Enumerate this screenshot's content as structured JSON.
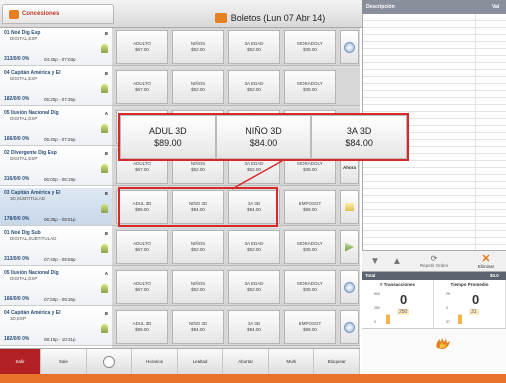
{
  "header": {
    "conc_tab": "Concesiones",
    "boletos_tab": "Boletos (Lun 07 Abr 14)"
  },
  "right_header": {
    "col1": "Descripción",
    "col2": "Val"
  },
  "movies": [
    {
      "title": "01 Noé Dig Esp",
      "format": "DIGITAL,ESP",
      "cls": "B",
      "stats": "313/0/0  0%",
      "time": "04:45p - 07:03p",
      "hl": false
    },
    {
      "title": "04 Capitán América y El",
      "format": "DIGITAL,ESP",
      "cls": "B",
      "stats": "182/0/0  0%",
      "time": "05:20p - 07:36p",
      "hl": false
    },
    {
      "title": "05 Ilusión Nacional Dig",
      "format": "DIGITAL,ESP",
      "cls": "A",
      "stats": "166/0/0  0%",
      "time": "05:40p - 07:26p",
      "hl": false
    },
    {
      "title": "02 Divergente Dig Esp",
      "format": "DIGITAL,ESP",
      "cls": "B",
      "stats": "316/0/0  0%",
      "time": "06:00p - 08:19p",
      "hl": false
    },
    {
      "title": "03 Capitán América y El",
      "format": "3D,SUBTITULAD",
      "cls": "B",
      "stats": "178/0/0  0%",
      "time": "06:35p - 08:51p",
      "hl": true
    },
    {
      "title": "01 Noé Dig Sub",
      "format": "DIGITAL,SUBTITULAD",
      "cls": "B",
      "stats": "313/0/0  0%",
      "time": "07:40p - 09:58p",
      "hl": false
    },
    {
      "title": "05 Ilusión Nacional Dig",
      "format": "DIGITAL,ESP",
      "cls": "A",
      "stats": "166/0/0  0%",
      "time": "07:50p - 09:36p",
      "hl": false
    },
    {
      "title": "04 Capitán América y El",
      "format": "3D,ESP",
      "cls": "B",
      "stats": "182/0/0  0%",
      "time": "08:15p - 10:31p",
      "hl": false
    }
  ],
  "rows": [
    {
      "cells": [
        [
          "ADULTO",
          "$67.00"
        ],
        [
          "NIÑOS",
          "$52.00"
        ],
        [
          "3A EDAD",
          "$52.00"
        ],
        [
          "MORADOLY",
          "$38.00"
        ]
      ],
      "act": "circ"
    },
    {
      "cells": [
        [
          "ADULTO",
          "$67.00"
        ],
        [
          "NIÑOS",
          "$52.00"
        ],
        [
          "3A EDAD",
          "$52.00"
        ],
        [
          "MORADOLY",
          "$38.00"
        ]
      ],
      "act": "none"
    },
    {
      "cells": [
        [
          "ADULTO",
          "$67.00"
        ],
        [
          "NIÑOS",
          "$52.00"
        ],
        [
          "3A EDAD",
          "$52.00"
        ],
        [
          "MORADOLY",
          "$38.00"
        ]
      ],
      "act": "none"
    },
    {
      "cells": [
        [
          "ADULTO",
          "$67.00"
        ],
        [
          "NIÑOS",
          "$52.00"
        ],
        [
          "3A EDAD",
          "$52.00"
        ],
        [
          "MORADOLY",
          "$38.00"
        ]
      ],
      "act": "Ahora"
    },
    {
      "cells": [
        [
          "ADUL 3D",
          "$89.00"
        ],
        [
          "NIÑO 3D",
          "$84.00"
        ],
        [
          "3A 3D",
          "$84.00"
        ],
        [
          "EMPOSGT",
          "$68.00"
        ]
      ],
      "act": "yel"
    },
    {
      "cells": [
        [
          "ADULTO",
          "$67.00"
        ],
        [
          "NIÑOS",
          "$52.00"
        ],
        [
          "3A EDAD",
          "$52.00"
        ],
        [
          "MORADOLY",
          "$38.00"
        ]
      ],
      "act": "grn"
    },
    {
      "cells": [
        [
          "ADULTO",
          "$67.00"
        ],
        [
          "NIÑOS",
          "$52.00"
        ],
        [
          "3A EDAD",
          "$52.00"
        ],
        [
          "MORADOLY",
          "$38.00"
        ]
      ],
      "act": "circ"
    },
    {
      "cells": [
        [
          "ADUL 3D",
          "$89.00"
        ],
        [
          "NIÑO 3D",
          "$84.00"
        ],
        [
          "3A 3D",
          "$84.00"
        ],
        [
          "EMPOSGT",
          "$68.00"
        ]
      ],
      "act": "circ"
    }
  ],
  "zoom": [
    [
      "ADUL 3D",
      "$89.00"
    ],
    [
      "NIÑO 3D",
      "$84.00"
    ],
    [
      "3A 3D",
      "$84.00"
    ]
  ],
  "bottom": [
    "Salir",
    "Sale",
    "",
    "Horarios",
    "Lealtad",
    "Abortar",
    "Multi",
    "Bloquear"
  ],
  "controls": {
    "repeat": "Repetir Orden",
    "delete": "Eliminar"
  },
  "totals": {
    "label": "Total",
    "value": "$0.0"
  },
  "kpi1": {
    "title": "# Transacciones",
    "value": "0",
    "goal": "250",
    "ticks": [
      "500",
      "250",
      "0"
    ]
  },
  "kpi2": {
    "title": "Tiempo Promedio",
    "value": "0",
    "goal": "31",
    "ticks": [
      "25",
      "0",
      "37"
    ]
  },
  "colors": {
    "accent": "#d62a2a",
    "status": "#e8742a",
    "title": "#2a4f7c"
  }
}
